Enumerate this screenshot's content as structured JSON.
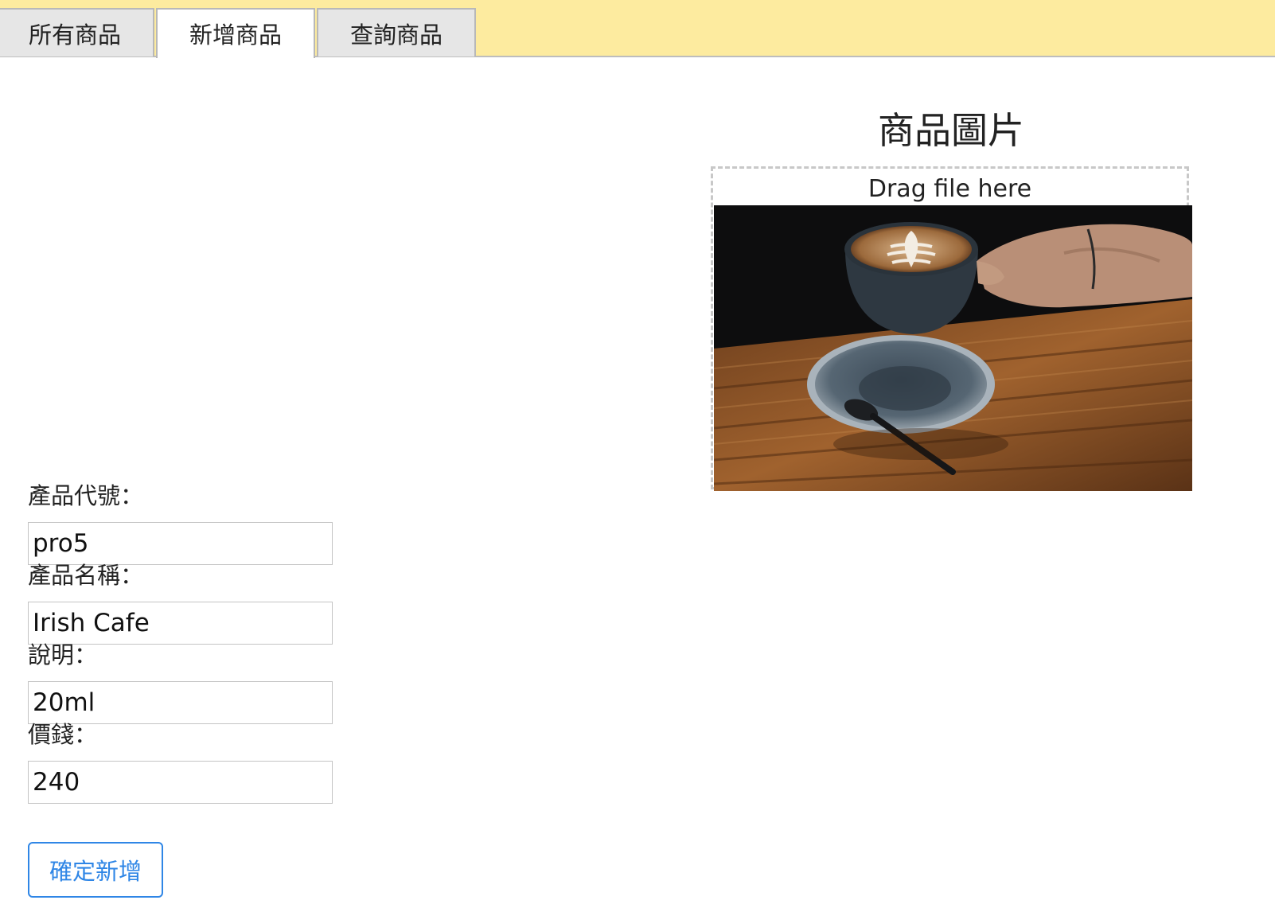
{
  "tabs": [
    {
      "label": "所有商品",
      "active": false
    },
    {
      "label": "新增商品",
      "active": true
    },
    {
      "label": "查詢商品",
      "active": false
    }
  ],
  "image_section": {
    "title": "商品圖片",
    "dropzone_text": "Drag file here"
  },
  "form": {
    "fields": [
      {
        "label": "產品代號：",
        "value": "pro5"
      },
      {
        "label": "產品名稱：",
        "value": "Irish Cafe"
      },
      {
        "label": "說明：",
        "value": "20ml"
      },
      {
        "label": "價錢：",
        "value": "240"
      }
    ],
    "submit_label": "確定新增"
  },
  "colors": {
    "tabbar_bg": "#fdeb9f",
    "accent": "#2f86e6"
  }
}
